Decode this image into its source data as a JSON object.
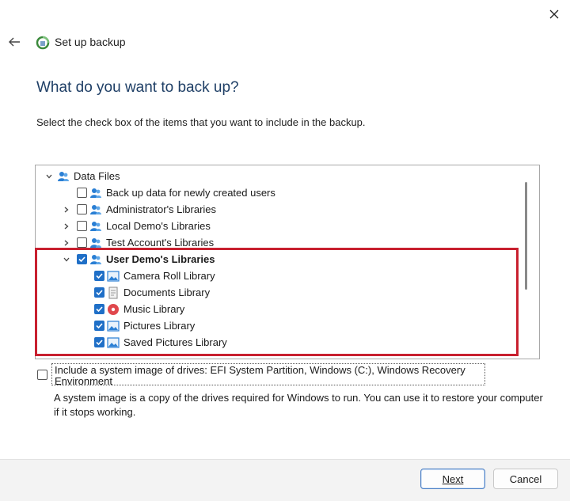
{
  "window": {
    "title": "Set up backup"
  },
  "page": {
    "heading": "What do you want to back up?",
    "instructions": "Select the check box of the items that you want to include in the backup."
  },
  "tree": {
    "root": {
      "label": "Data Files",
      "expanded": true
    },
    "items": [
      {
        "label": "Back up data for newly created users",
        "checked": false,
        "expandable": false,
        "icon": "users-icon"
      },
      {
        "label": "Administrator's Libraries",
        "checked": false,
        "expandable": true,
        "icon": "users-icon"
      },
      {
        "label": "Local Demo's Libraries",
        "checked": false,
        "expandable": true,
        "icon": "users-icon"
      },
      {
        "label": "Test Account's Libraries",
        "checked": false,
        "expandable": true,
        "icon": "users-icon"
      },
      {
        "label": "User Demo's Libraries",
        "checked": true,
        "expandable": true,
        "expanded": true,
        "bold": true,
        "icon": "users-icon"
      }
    ],
    "children": [
      {
        "label": "Camera Roll Library",
        "checked": true,
        "icon": "image-library-icon"
      },
      {
        "label": "Documents Library",
        "checked": true,
        "icon": "documents-library-icon"
      },
      {
        "label": "Music Library",
        "checked": true,
        "icon": "music-library-icon"
      },
      {
        "label": "Pictures Library",
        "checked": true,
        "icon": "image-library-icon"
      },
      {
        "label": "Saved Pictures Library",
        "checked": true,
        "icon": "image-library-icon"
      }
    ]
  },
  "system_image": {
    "checked": false,
    "label": "Include a system image of drives: EFI System Partition, Windows (C:), Windows Recovery Environment",
    "description": "A system image is a copy of the drives required for Windows to run. You can use it to restore your computer if it stops working."
  },
  "buttons": {
    "next": "Next",
    "cancel": "Cancel"
  },
  "colors": {
    "heading": "#1f3f66",
    "checkbox_checked": "#1f6fc7",
    "highlight": "#c8202f"
  }
}
